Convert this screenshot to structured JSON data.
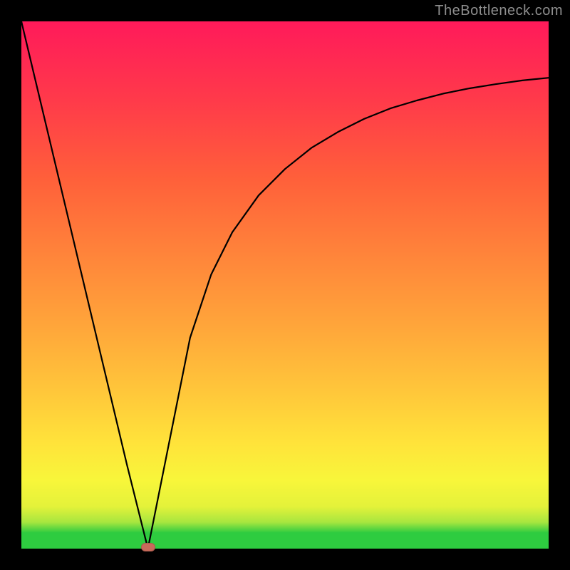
{
  "watermark": "TheBottleneck.com",
  "colors": {
    "background": "#000000",
    "curve_stroke": "#000000",
    "marker_fill": "#c96a5b",
    "gradient_top": "#ff1a5a",
    "gradient_bottom": "#2ecc40"
  },
  "chart_data": {
    "type": "line",
    "title": "",
    "xlabel": "",
    "ylabel": "",
    "xlim": [
      0,
      100
    ],
    "ylim": [
      0,
      100
    ],
    "annotations": [
      "TheBottleneck.com"
    ],
    "series": [
      {
        "name": "bottleneck-curve",
        "x": [
          0,
          5,
          10,
          15,
          20,
          24,
          28,
          32,
          36,
          40,
          45,
          50,
          55,
          60,
          65,
          70,
          75,
          80,
          85,
          90,
          95,
          100
        ],
        "y": [
          100,
          79,
          58,
          37,
          16,
          0,
          20,
          40,
          52,
          60,
          67,
          72,
          76,
          79,
          81.5,
          83.5,
          85,
          86.3,
          87.3,
          88.1,
          88.8,
          89.3
        ]
      }
    ],
    "optimum_x": 24,
    "optimum_y": 0
  }
}
